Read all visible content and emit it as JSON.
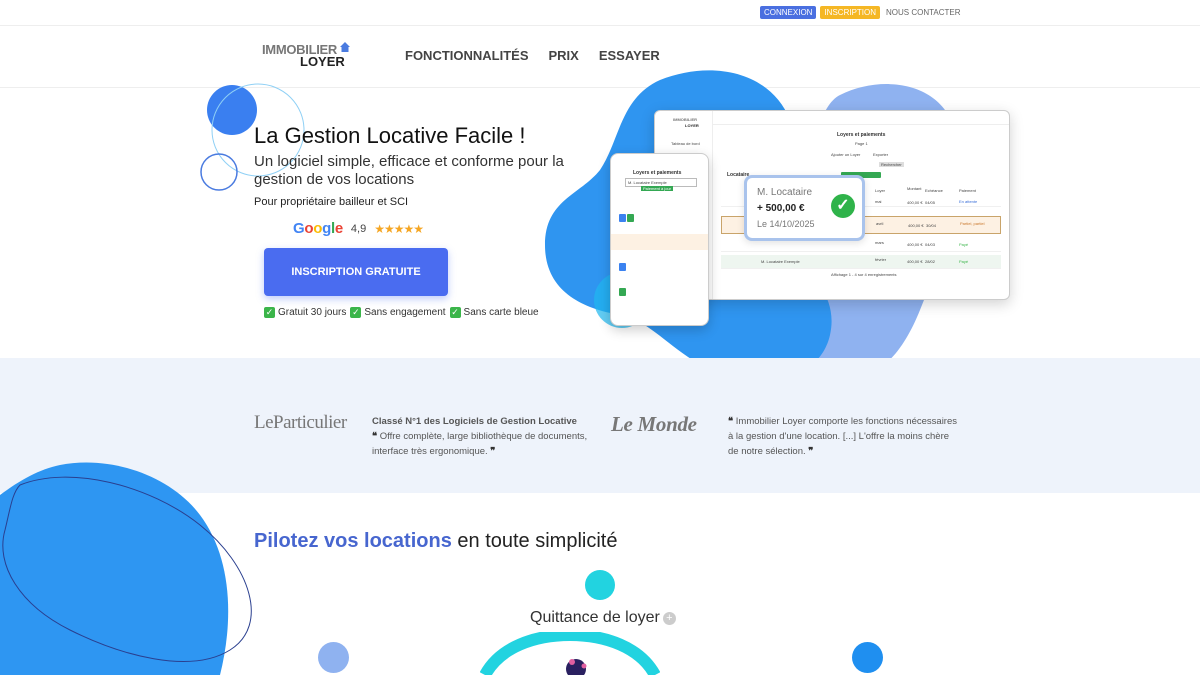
{
  "topbar": {
    "connexion": "CONNEXION",
    "inscription": "INSCRIPTION",
    "contact": "NOUS CONTACTER"
  },
  "header": {
    "logo_line1": "IMMOBILIER",
    "logo_line2": "LOYER",
    "nav": [
      "FONCTIONNALITÉS",
      "PRIX",
      "ESSAYER"
    ]
  },
  "hero": {
    "title": "La Gestion Locative Facile !",
    "subtitle": "Un logiciel simple, efficace et conforme pour la gestion de vos locations",
    "audience": "Pour propriétaire bailleur et SCI",
    "google_label": "Google",
    "rating": "4,9",
    "stars": "★★★★★",
    "cta": "INSCRIPTION GRATUITE",
    "perks": [
      "Gratuit 30 jours",
      "Sans engagement",
      "Sans carte bleue"
    ]
  },
  "mockup": {
    "desktop_logo1": "IMMOBILIER",
    "desktop_logo2": "LOYER",
    "desktop_nav_item": "Tableau de bord",
    "desktop_title": "Loyers et paiements",
    "desktop_page": "Page 1",
    "add_rent": "Ajouter un Loyer",
    "export": "Exporter",
    "search_btn": "Rechercher",
    "table_heading": "Locataire",
    "col_loyer": "Loyer",
    "col_montant": "Montant",
    "col_echeance": "Echéance",
    "col_paiement": "Paiement",
    "rows": [
      {
        "month": "mai",
        "amount": "400,00 €",
        "date": "04/05",
        "status": "En attente"
      },
      {
        "month": "avril",
        "amount": "400,00 €",
        "date": "30/04",
        "status": "Partiel, partiel"
      },
      {
        "month": "mars",
        "amount": "400,00 €",
        "date": "04/03",
        "status": "Payé"
      },
      {
        "month": "février",
        "amount": "400,00 €",
        "date": "28/02",
        "status": "Payé"
      }
    ],
    "tenant": "M. Locataire Exemple",
    "footer": "Affichage 1 - 4 sur 4 enregistrements",
    "phone_title": "Loyers et paiements",
    "phone_select": "M. Locataire Exemple",
    "phone_btn": "Paiement à jour",
    "payment_name": "M. Locataire",
    "payment_amount": "+ 500,00 €",
    "payment_date": "Le 14/10/2025"
  },
  "press": {
    "logo1": "LeParticulier",
    "quote1_head": "Classé N°1 des Logiciels de Gestion Locative",
    "quote1_body": "Offre complète, large bibliothèque de documents, interface très ergonomique.",
    "logo2": "Le Monde",
    "quote2_body": "Immobilier Loyer comporte les fonctions nécessaires à la gestion d'une location. [...] L'offre la moins chère de notre sélection."
  },
  "section2": {
    "title_accent": "Pilotez vos locations",
    "title_rest": "en toute simplicité",
    "feature": "Quittance de loyer"
  },
  "colors": {
    "accent": "#4a6cf0",
    "blob_blue": "#2b8ff0",
    "blob_light": "#8fb2f0",
    "press_bg": "#eef3fb"
  }
}
